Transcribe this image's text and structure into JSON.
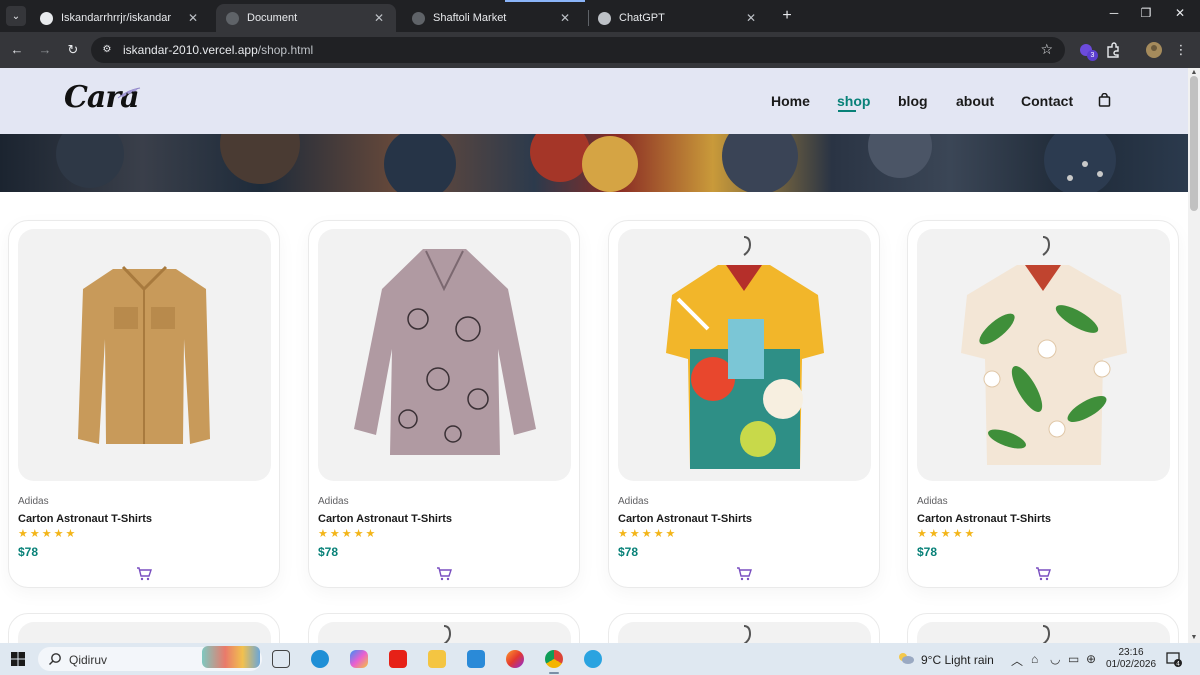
{
  "browser": {
    "tabs": [
      {
        "title": "Iskandarrhrrjr/iskandar",
        "active": false
      },
      {
        "title": "Document",
        "active": true
      },
      {
        "title": "Shaftoli Market",
        "active": false
      },
      {
        "title": "ChatGPT",
        "active": false
      }
    ],
    "url_host": "iskandar-2010.vercel.app",
    "url_path": "/shop.html",
    "extension_badge": "3"
  },
  "site": {
    "logo": "Cara",
    "nav": [
      {
        "label": "Home",
        "active": false
      },
      {
        "label": "shop",
        "active": true
      },
      {
        "label": "blog",
        "active": false
      },
      {
        "label": "about",
        "active": false
      },
      {
        "label": "Contact",
        "active": false
      }
    ],
    "accent_color": "#088178"
  },
  "products": [
    {
      "brand": "Adidas",
      "name": "Carton Astronaut T-Shirts",
      "stars": "★★★★★",
      "rating": 5,
      "price": "$78",
      "image": "khaki-shirt"
    },
    {
      "brand": "Adidas",
      "name": "Carton Astronaut T-Shirts",
      "stars": "★★★★★",
      "rating": 5,
      "price": "$78",
      "image": "mauve-blouse"
    },
    {
      "brand": "Adidas",
      "name": "Carton Astronaut T-Shirts",
      "stars": "★★★★★",
      "rating": 5,
      "price": "$78",
      "image": "colorful-shirt"
    },
    {
      "brand": "Adidas",
      "name": "Carton Astronaut T-Shirts",
      "stars": "★★★★★",
      "rating": 5,
      "price": "$78",
      "image": "floral-shirt"
    }
  ],
  "taskbar": {
    "search_placeholder": "Qidiruv",
    "weather": "9°C  Light rain",
    "time": "23:16",
    "date": "01/02/2026",
    "notification_count": "4"
  }
}
